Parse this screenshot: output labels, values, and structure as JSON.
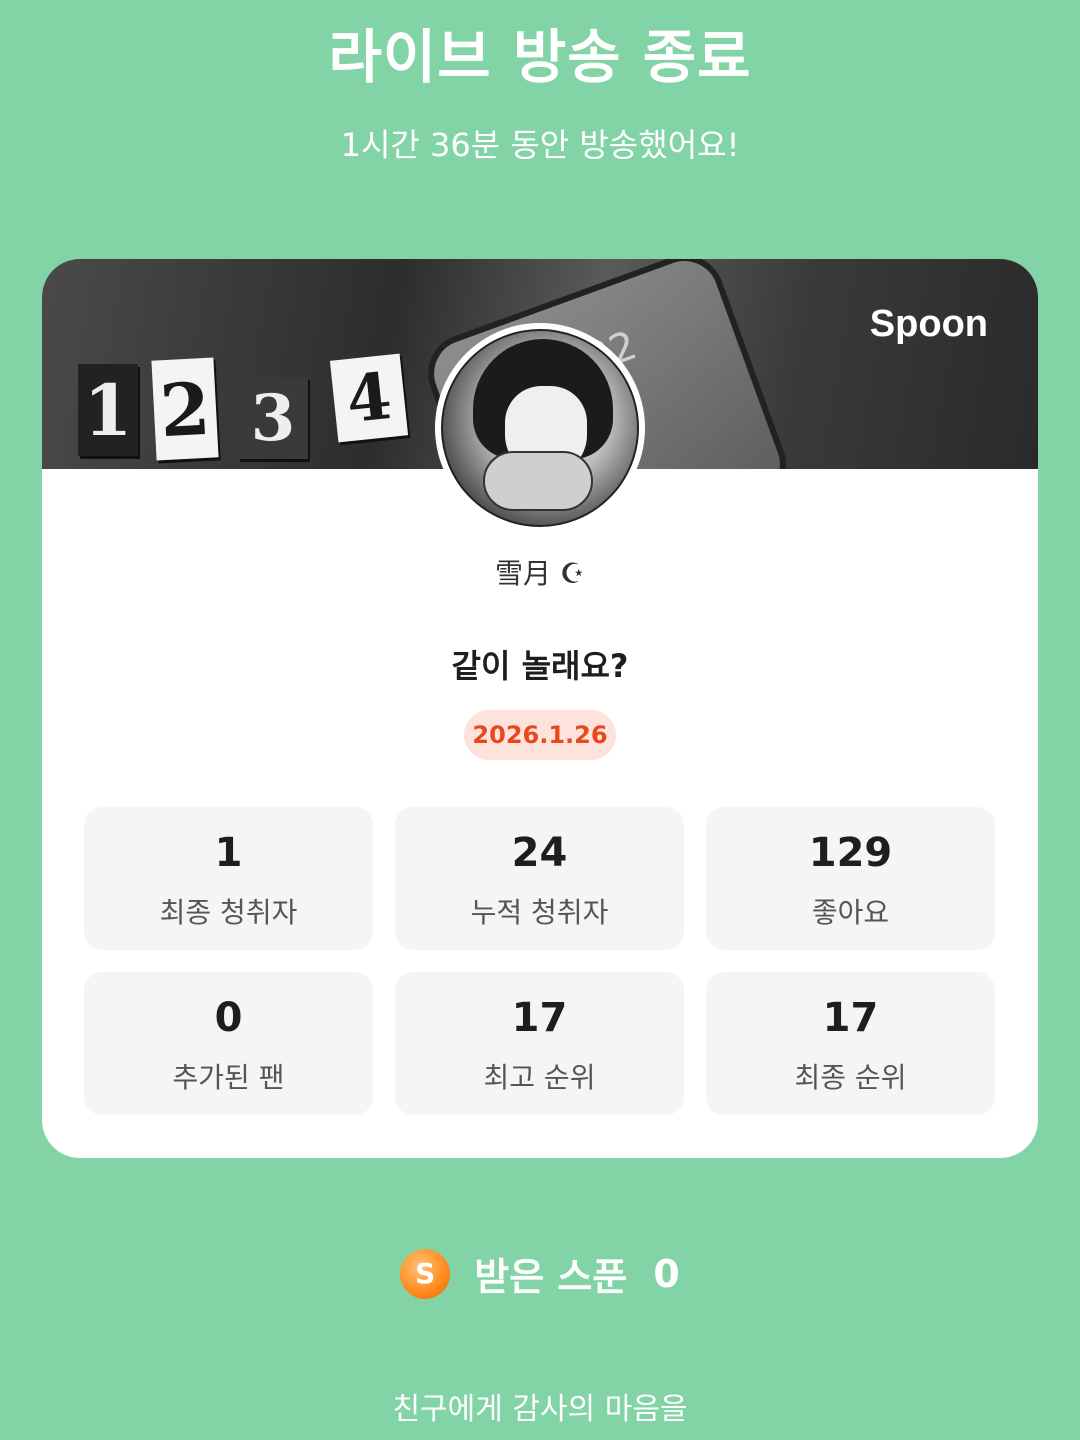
{
  "header": {
    "title": "라이브 방송 종료",
    "subtitle": "1시간 36분 동안 방송했어요!"
  },
  "card": {
    "banner": {
      "brand": "Spoon",
      "tiles": [
        "1",
        "2",
        "3",
        "4"
      ],
      "phone_clock": "32"
    },
    "username": "雪月 ☪",
    "room_title": "같이 놀래요?",
    "date": "2026.1.26",
    "stats": [
      {
        "value": "1",
        "label": "최종 청취자"
      },
      {
        "value": "24",
        "label": "누적 청취자"
      },
      {
        "value": "129",
        "label": "좋아요"
      },
      {
        "value": "0",
        "label": "추가된 팬"
      },
      {
        "value": "17",
        "label": "최고 순위"
      },
      {
        "value": "17",
        "label": "최종 순위"
      }
    ]
  },
  "spoons": {
    "coin_letter": "S",
    "label": "받은 스푼",
    "count": "0"
  },
  "footer": {
    "text": "친구에게 감사의 마음을"
  },
  "colors": {
    "background": "#82d4a7",
    "date_badge_bg": "#fde3dc",
    "date_text": "#e8481e",
    "coin": "#ff8a1c"
  }
}
